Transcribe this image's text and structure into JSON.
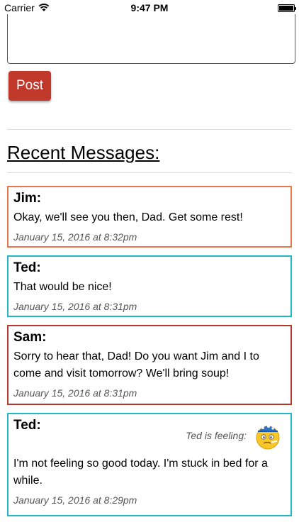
{
  "status_bar": {
    "carrier": "Carrier",
    "time": "9:47 PM"
  },
  "composer": {
    "post_label": "Post"
  },
  "section_title": "Recent Messages:",
  "messages": [
    {
      "author": "Jim:",
      "text": "Okay, we'll see you then, Dad. Get some rest!",
      "time": "January 15, 2016 at 8:32pm",
      "color": "#e8784a"
    },
    {
      "author": "Ted:",
      "text": "That would be nice!",
      "time": "January 15, 2016 at 8:31pm",
      "color": "#22b7c8"
    },
    {
      "author": "Sam:",
      "text": "Sorry to hear that, Dad! Do you want Jim and I to come and visit tomorrow? We'll bring soup!",
      "time": "January 15, 2016 at 8:31pm",
      "color": "#b23a2e"
    },
    {
      "author": "Ted:",
      "feeling_label": "Ted is feeling:",
      "feeling_icon": "sick-face-icon",
      "text": "I'm not feeling so good today. I'm stuck in bed for a while.",
      "time": "January 15, 2016 at 8:29pm",
      "color": "#22b7c8"
    }
  ]
}
